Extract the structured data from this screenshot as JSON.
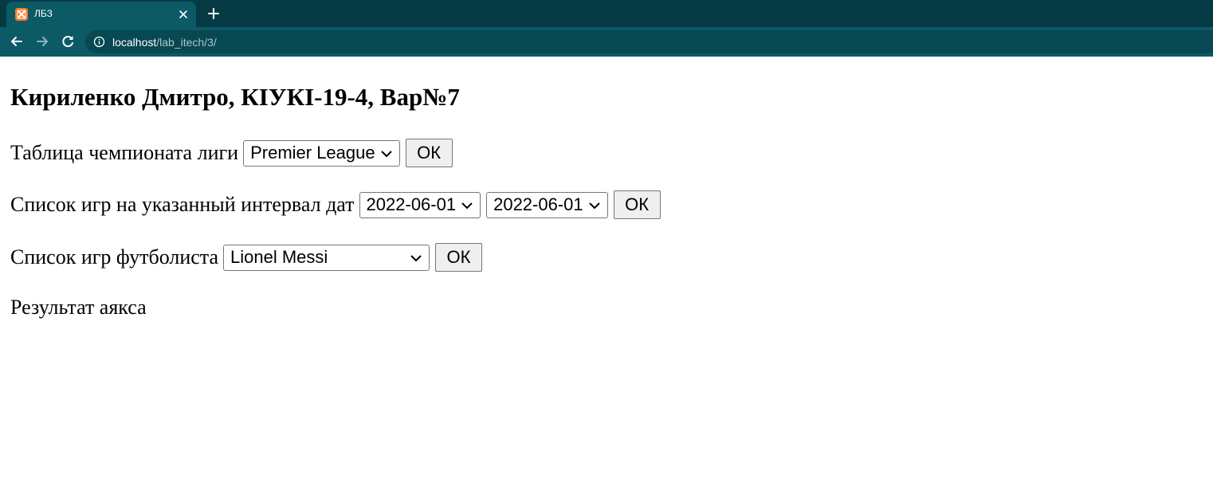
{
  "browser": {
    "tab_title": "ЛБЗ",
    "url_host": "localhost",
    "url_path": "/lab_itech/3/",
    "icons": {
      "favicon": "xampp-icon",
      "close": "close-icon",
      "new_tab": "plus-icon",
      "back": "arrow-left-icon",
      "forward": "arrow-right-icon",
      "reload": "reload-icon",
      "site_info": "info-icon"
    }
  },
  "page": {
    "heading": "Кириленко Дмитро, КІУКІ-19-4, Вар№7",
    "league_form": {
      "label": "Таблица чемпионата лиги",
      "selected_league": "Premier League",
      "ok_label": "ОК"
    },
    "dates_form": {
      "label": "Список игр на указанный интервал дат",
      "date_from": "2022-06-01",
      "date_to": "2022-06-01",
      "ok_label": "ОК"
    },
    "player_form": {
      "label": "Список игр футболиста",
      "selected_player": "Lionel Messi",
      "ok_label": "ОК"
    },
    "result_text": "Результат аякса"
  },
  "colors": {
    "tabstrip": "#053a45",
    "toolbar": "#0b5a66",
    "favicon": "#fb7a24"
  }
}
